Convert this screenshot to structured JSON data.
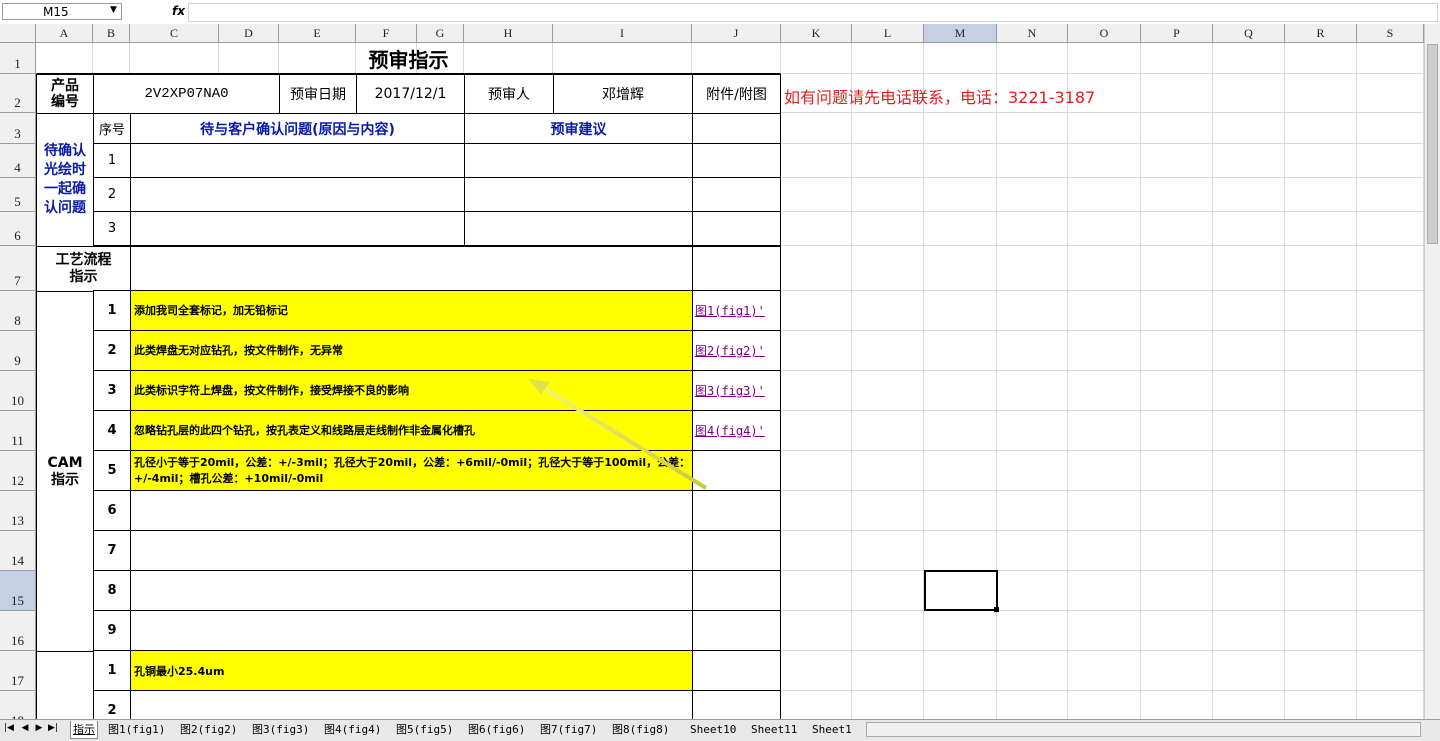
{
  "formula_bar": {
    "name_box": "M15",
    "fx_label": "fx",
    "formula": ""
  },
  "columns": [
    "A",
    "B",
    "C",
    "D",
    "E",
    "F",
    "G",
    "H",
    "I",
    "J",
    "K",
    "L",
    "M",
    "N",
    "O",
    "P",
    "Q",
    "R",
    "S"
  ],
  "rows": [
    "1",
    "2",
    "3",
    "4",
    "5",
    "6",
    "7",
    "8",
    "9",
    "10",
    "11",
    "12",
    "13",
    "14",
    "15",
    "16",
    "17",
    "18"
  ],
  "selected_cell": "M15",
  "sheet": {
    "title": "预审指示",
    "product_no_label": "产品\n编号",
    "product_no": "2V2XP07NA0",
    "review_date_label": "预审日期",
    "review_date": "2017/12/1",
    "reviewer_label": "预审人",
    "reviewer": "邓增辉",
    "attachment_label": "附件/附图",
    "contact_note": "如有问题请先电话联系，电话：3221-3187",
    "confirm_section_label": "待确认光绘时一起确认问题",
    "seq_label": "序号",
    "customer_issue_header": "待与客户确认问题(原因与内容)",
    "review_advice_header": "预审建议",
    "confirm_rows": [
      "1",
      "2",
      "3"
    ],
    "process_label": "工艺流程指示",
    "cam_label": "CAM\n指示",
    "cam_rows": [
      {
        "seq": "1",
        "text": "添加我司全套标记，加无铅标记",
        "link": "图1(fig1)'"
      },
      {
        "seq": "2",
        "text": "此类焊盘无对应钻孔，按文件制作，无异常",
        "link": "图2(fig2)'"
      },
      {
        "seq": "3",
        "text": "此类标识字符上焊盘，按文件制作，接受焊接不良的影响",
        "link": "图3(fig3)'"
      },
      {
        "seq": "4",
        "text": "忽略钻孔层的此四个钻孔，按孔表定义和线路层走线制作非金属化槽孔",
        "link": "图4(fig4)'"
      },
      {
        "seq": "5",
        "text": "孔径小于等于20mil，公差：+/-3mil；孔径大于20mil，公差：+6mil/-0mil；孔径大于等于100mil，公差：+/-4mil；槽孔公差：+10mil/-0mil",
        "link": ""
      },
      {
        "seq": "6",
        "text": "",
        "link": ""
      },
      {
        "seq": "7",
        "text": "",
        "link": ""
      },
      {
        "seq": "8",
        "text": "",
        "link": ""
      },
      {
        "seq": "9",
        "text": "",
        "link": ""
      }
    ],
    "next_rows": [
      {
        "seq": "1",
        "text": "孔铜最小25.4um"
      },
      {
        "seq": "2",
        "text": ""
      }
    ]
  },
  "sheet_tabs": [
    "指示",
    "图1(fig1)",
    "图2(fig2)",
    "图3(fig3)",
    "图4(fig4)",
    "图5(fig5)",
    "图6(fig6)",
    "图7(fig7)",
    "图8(fig8)",
    "Sheet10",
    "Sheet11",
    "Sheet1"
  ],
  "active_tab": "指示",
  "colors": {
    "highlight": "#ffff00",
    "header_blue": "#0a1aa8",
    "note_red": "#e0201e",
    "link_purple": "#800080",
    "arrow": "#e6e64a"
  }
}
